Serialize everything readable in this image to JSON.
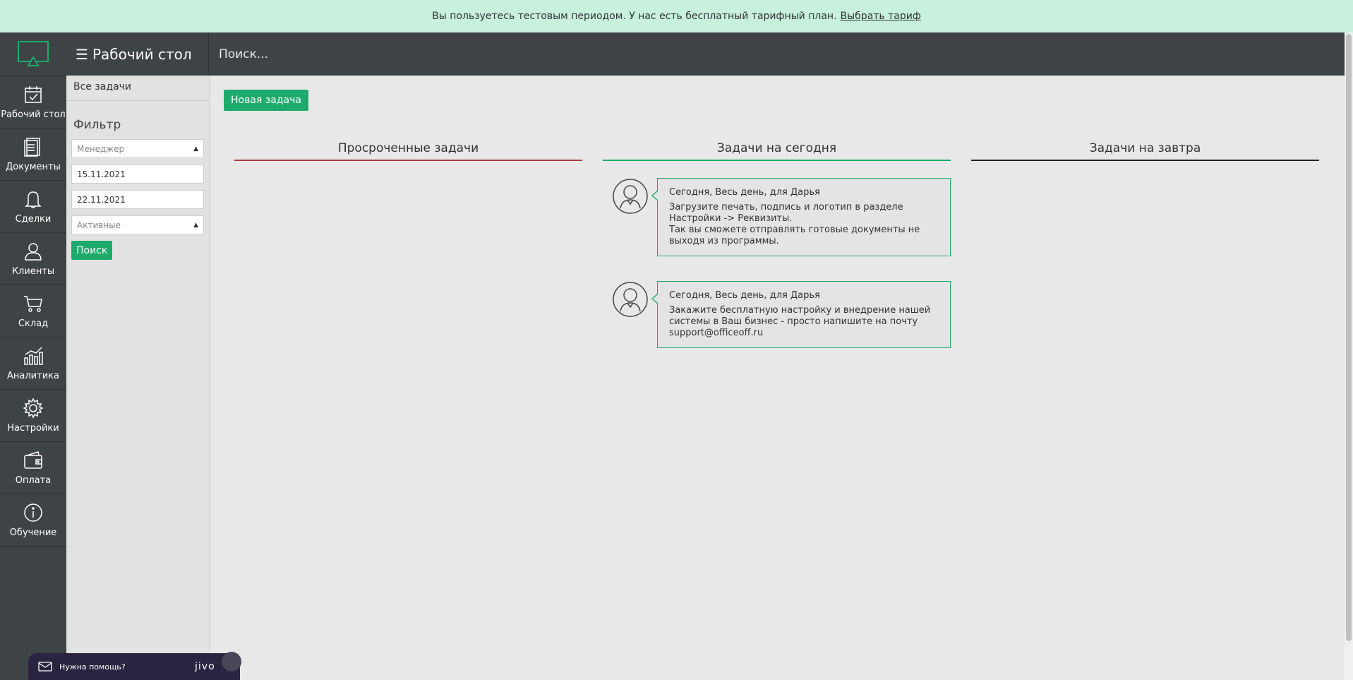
{
  "banner": {
    "text": "Вы пользуетесь тестовым периодом. У нас есть бесплатный тарифный план.",
    "link": "Выбрать тариф"
  },
  "rail": {
    "items": [
      {
        "label": "Рабочий стол",
        "icon": "calendar-check-icon"
      },
      {
        "label": "Документы",
        "icon": "document-icon"
      },
      {
        "label": "Сделки",
        "icon": "bell-icon"
      },
      {
        "label": "Клиенты",
        "icon": "users-icon"
      },
      {
        "label": "Склад",
        "icon": "cart-icon"
      },
      {
        "label": "Аналитика",
        "icon": "chart-icon"
      },
      {
        "label": "Настройки",
        "icon": "gear-icon"
      },
      {
        "label": "Оплата",
        "icon": "wallet-icon"
      },
      {
        "label": "Обучение",
        "icon": "info-icon"
      }
    ]
  },
  "header": {
    "title": "Рабочий стол",
    "search_placeholder": "Поиск..."
  },
  "filter": {
    "all_tasks": "Все задачи",
    "title": "Фильтр",
    "manager_placeholder": "Менеджер",
    "date_from": "15.11.2021",
    "date_to": "22.11.2021",
    "status": "Активные",
    "search_button": "Поиск"
  },
  "main": {
    "new_task_button": "Новая задача",
    "columns": {
      "overdue": "Просроченные задачи",
      "today": "Задачи на сегодня",
      "tomorrow": "Задачи на завтра"
    },
    "tasks": [
      {
        "meta": "Сегодня, Весь день, для Дарья",
        "text": "Загрузите печать, подпись и логотип в разделе\nНастройки -> Реквизиты.\nТак вы сможете отправлять готовые документы не\nвыходя из программы."
      },
      {
        "meta": "Сегодня, Весь день, для Дарья",
        "text": "Закажите бесплатную настройку и внедрение нашей\nсистемы в Ваш бизнес - просто напишите на почту\nsupport@officeoff.ru"
      }
    ]
  },
  "help": {
    "label": "Нужна помощь?",
    "brand": "jivo"
  },
  "colors": {
    "accent": "#1cab6c",
    "dark": "#3e4446",
    "banner": "#c8f0df",
    "overdue_line": "#b03a36"
  }
}
